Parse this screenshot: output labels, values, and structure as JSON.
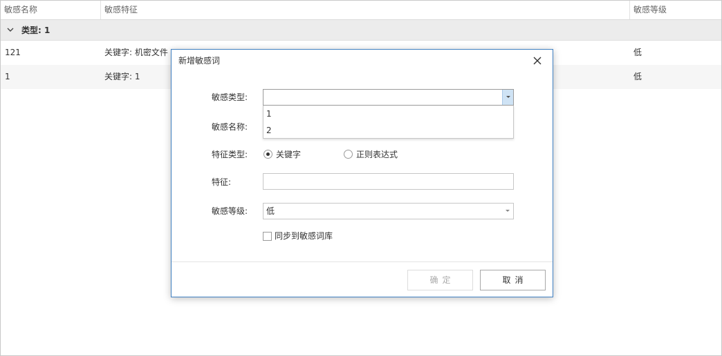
{
  "table": {
    "columns": [
      "敏感名称",
      "敏感特征",
      "敏感等级"
    ],
    "group_label": "类型: 1",
    "rows": [
      {
        "name": "121",
        "feature": "关键字: 机密文件",
        "level": "低"
      },
      {
        "name": "1",
        "feature": "关键字: 1",
        "level": "低"
      }
    ]
  },
  "dialog": {
    "title": "新增敏感词",
    "labels": {
      "type": "敏感类型:",
      "name": "敏感名称:",
      "feature_type": "特征类型:",
      "feature": "特征:",
      "level": "敏感等级:"
    },
    "type_value": "",
    "type_options": [
      "1",
      "2"
    ],
    "feature_type_options": [
      {
        "label": "关键字",
        "selected": true
      },
      {
        "label": "正则表达式",
        "selected": false
      }
    ],
    "feature_value": "",
    "level_value": "低",
    "sync_label": "同步到敏感词库",
    "sync_checked": false,
    "ok_label": "确定",
    "cancel_label": "取消"
  },
  "icons": {
    "group_toggle": "chevron-down-icon",
    "close": "close-icon",
    "dropdown": "dropdown-arrow-icon"
  },
  "colors": {
    "dialog_border": "#3f7fc1",
    "dropdown_button": "#cfe3f5",
    "group_row": "#ececec"
  }
}
